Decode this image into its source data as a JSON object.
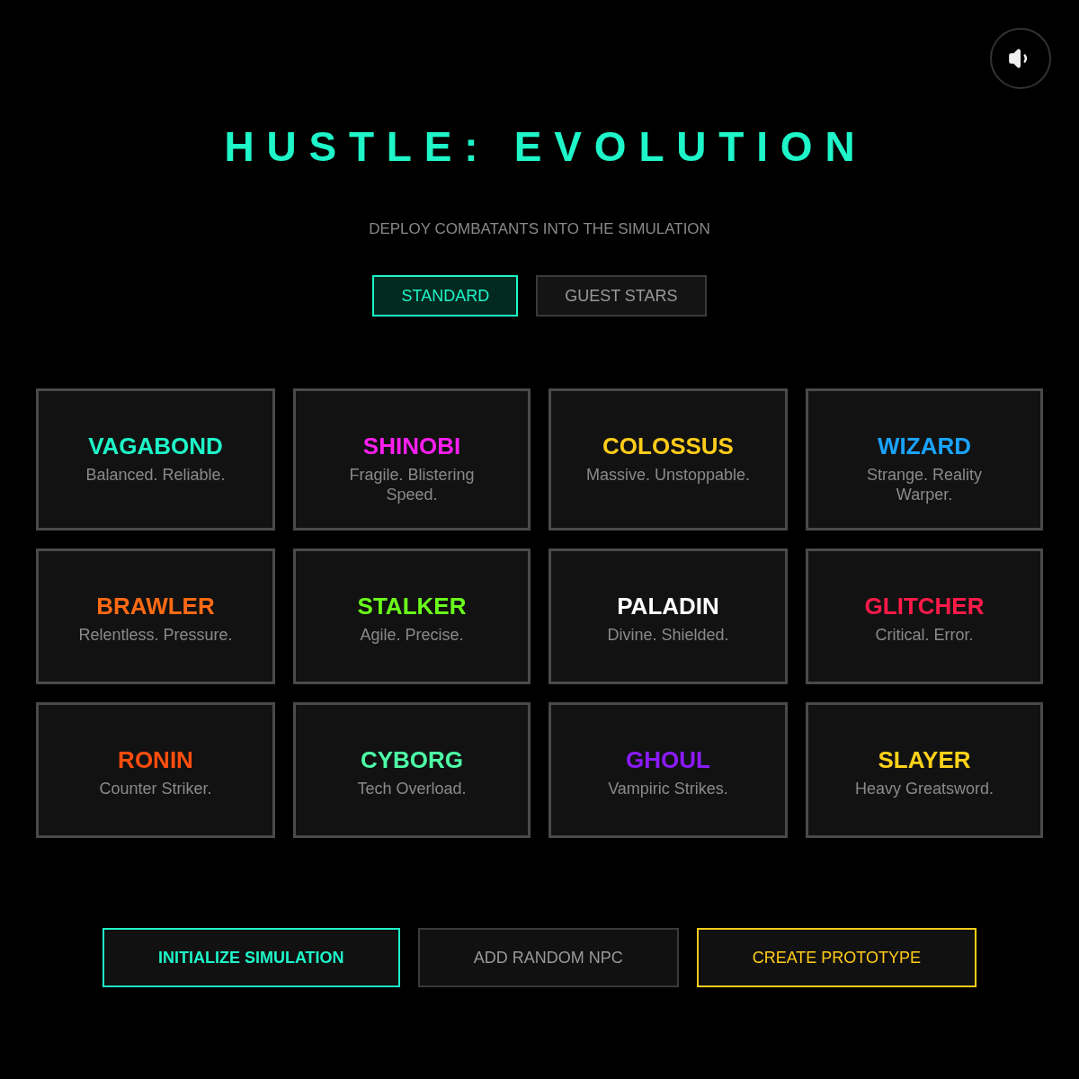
{
  "sound_button": {
    "on": true
  },
  "title": "HUSTLE: EVOLUTION",
  "subtitle": "DEPLOY COMBATANTS INTO THE SIMULATION",
  "tabs": [
    {
      "label": "STANDARD",
      "selected": true
    },
    {
      "label": "GUEST STARS",
      "selected": false
    }
  ],
  "characters": [
    {
      "name": "VAGABOND",
      "description": "Balanced. Reliable.",
      "color": "#1ef5c8"
    },
    {
      "name": "SHINOBI",
      "description": "Fragile. Blistering Speed.",
      "color": "#ff1ff0"
    },
    {
      "name": "COLOSSUS",
      "description": "Massive. Unstoppable.",
      "color": "#ffcc1a"
    },
    {
      "name": "WIZARD",
      "description": "Strange. Reality Warper.",
      "color": "#1aa3ff"
    },
    {
      "name": "BRAWLER",
      "description": "Relentless. Pressure.",
      "color": "#ff6a14"
    },
    {
      "name": "STALKER",
      "description": "Agile. Precise.",
      "color": "#6aff1a"
    },
    {
      "name": "PALADIN",
      "description": "Divine. Shielded.",
      "color": "#ffffff"
    },
    {
      "name": "GLITCHER",
      "description": "Critical. Error.",
      "color": "#ff1a4a"
    },
    {
      "name": "RONIN",
      "description": "Counter Striker.",
      "color": "#ff4d0d"
    },
    {
      "name": "CYBORG",
      "description": "Tech Overload.",
      "color": "#4dffa6"
    },
    {
      "name": "GHOUL",
      "description": "Vampiric Strikes.",
      "color": "#8c1aff"
    },
    {
      "name": "SLAYER",
      "description": "Heavy Greatsword.",
      "color": "#ffd21a"
    }
  ],
  "actions": [
    {
      "label": "INITIALIZE SIMULATION",
      "kind": "primary"
    },
    {
      "label": "ADD RANDOM NPC",
      "kind": "secondary"
    },
    {
      "label": "CREATE PROTOTYPE",
      "kind": "accent"
    }
  ]
}
